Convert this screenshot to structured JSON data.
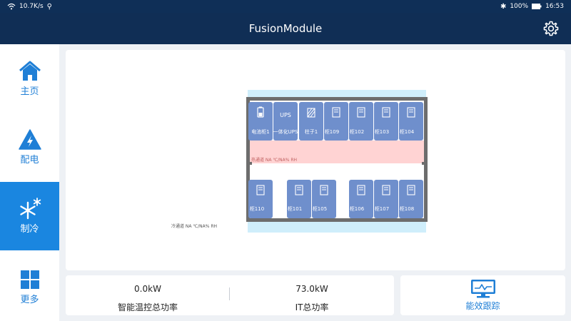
{
  "status_bar": {
    "network_speed": "10.7K/s",
    "battery": "100%",
    "time": "16:53"
  },
  "header": {
    "title": "FusionModule",
    "settings_icon": "gear-icon"
  },
  "sidebar": {
    "items": [
      {
        "label": "主页",
        "icon": "home-icon",
        "active": false
      },
      {
        "label": "配电",
        "icon": "power-distribution-icon",
        "active": false
      },
      {
        "label": "制冷",
        "icon": "snowflake-icon",
        "active": true
      },
      {
        "label": "更多",
        "icon": "grid-icon",
        "active": false
      }
    ]
  },
  "floor_plan": {
    "top_row": [
      {
        "label": "电池柜1",
        "icon": "battery-icon"
      },
      {
        "label": "一体化UPS",
        "icon": "ups-text",
        "icon_text": "UPS"
      },
      {
        "label": "柱子1",
        "icon": "pillar-icon"
      },
      {
        "label": "柜109",
        "icon": "cabinet-icon"
      },
      {
        "label": "柜102",
        "icon": "cabinet-icon"
      },
      {
        "label": "柜103",
        "icon": "cabinet-icon"
      },
      {
        "label": "柜104",
        "icon": "cabinet-icon"
      }
    ],
    "bottom_row": [
      {
        "label": "柜110",
        "icon": "cabinet-icon"
      },
      {
        "label": "柜101",
        "icon": "cabinet-icon"
      },
      {
        "label": "柜105",
        "icon": "cabinet-icon"
      },
      {
        "label": "柜106",
        "icon": "cabinet-icon"
      },
      {
        "label": "柜107",
        "icon": "cabinet-icon"
      },
      {
        "label": "柜108",
        "icon": "cabinet-icon"
      }
    ],
    "hot_aisle_label": "热通道 NA ℃/NA% RH",
    "cold_aisle_label": "冷通道 NA ℃/NA% RH",
    "colors": {
      "cabinet": "#6f8fcc",
      "hot_aisle": "#ffd3d3",
      "cold_aisle": "#cfeefb",
      "wall": "#6d6d6d"
    }
  },
  "stats": {
    "smart_temp_power": {
      "value": "0.0kW",
      "label": "智能温控总功率"
    },
    "it_power": {
      "value": "73.0kW",
      "label": "IT总功率"
    }
  },
  "efficiency": {
    "label": "能效跟踪",
    "icon": "monitor-chart-icon"
  }
}
